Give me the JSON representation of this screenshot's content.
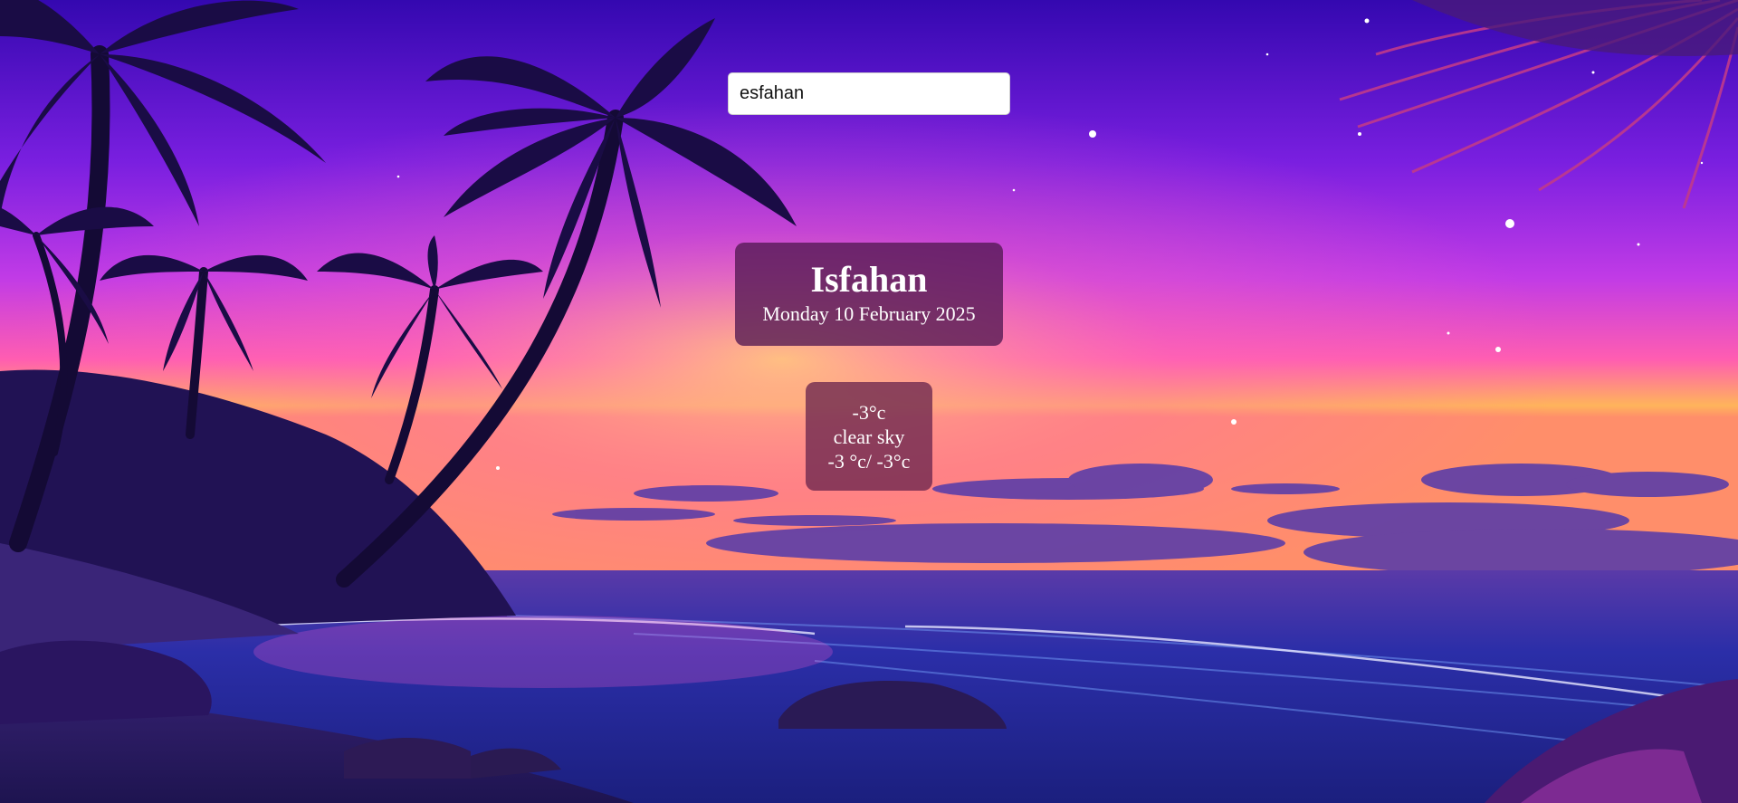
{
  "search": {
    "value": "esfahan"
  },
  "location": {
    "city": "Isfahan",
    "date": "Monday 10 February 2025"
  },
  "weather": {
    "temp": "-3°c",
    "description": "clear sky",
    "range": "-3 °c/ -3°c"
  },
  "theme": {
    "sky_top": "#3a0bb8",
    "sky_mid": "#9d2fe0",
    "horizon_pink": "#ff4fb8",
    "horizon_orange": "#ffb35a",
    "ocean": "#1d2f9c",
    "sand": "#2c1d6a",
    "card_bg": "#521852",
    "weather_card_bg": "#6c264e"
  }
}
